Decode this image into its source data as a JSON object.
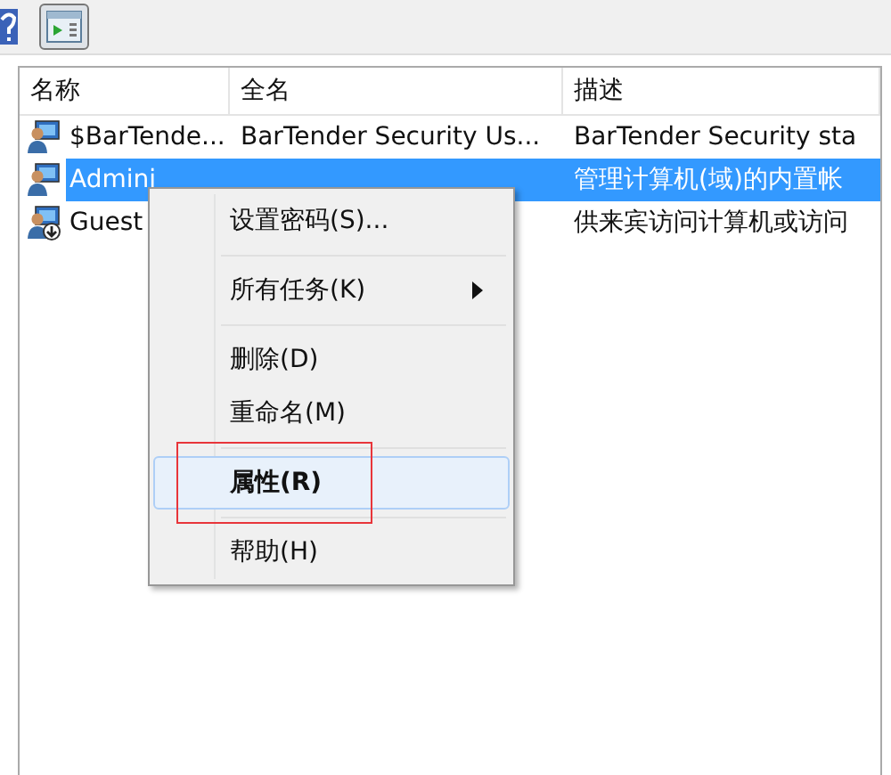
{
  "table": {
    "columns": [
      "名称",
      "全名",
      "描述"
    ],
    "rows": [
      {
        "name": "$BarTende...",
        "full_name": "BarTender Security Us...",
        "description": "BarTender Security sta",
        "selected": false,
        "disabled": false
      },
      {
        "name": "Admini",
        "description": "管理计算机(域)的内置帐",
        "selected": true,
        "disabled": false
      },
      {
        "name": "Guest",
        "description": "供来宾访问计算机或访问",
        "selected": false,
        "disabled": true
      }
    ]
  },
  "context_menu": {
    "items": [
      {
        "kind": "item",
        "label": "设置密码(S)...",
        "selected": false,
        "default": false,
        "submenu": false,
        "annotated": false
      },
      {
        "kind": "separator"
      },
      {
        "kind": "item",
        "label": "所有任务(K)",
        "selected": false,
        "default": false,
        "submenu": true,
        "annotated": false
      },
      {
        "kind": "separator"
      },
      {
        "kind": "item",
        "label": "删除(D)",
        "selected": false,
        "default": false,
        "submenu": false,
        "annotated": false
      },
      {
        "kind": "item",
        "label": "重命名(M)",
        "selected": false,
        "default": false,
        "submenu": false,
        "annotated": false
      },
      {
        "kind": "separator"
      },
      {
        "kind": "item",
        "label": "属性(R)",
        "selected": true,
        "default": true,
        "submenu": false,
        "annotated": true
      },
      {
        "kind": "separator"
      },
      {
        "kind": "item",
        "label": "帮助(H)",
        "selected": false,
        "default": false,
        "submenu": false,
        "annotated": false
      }
    ]
  }
}
